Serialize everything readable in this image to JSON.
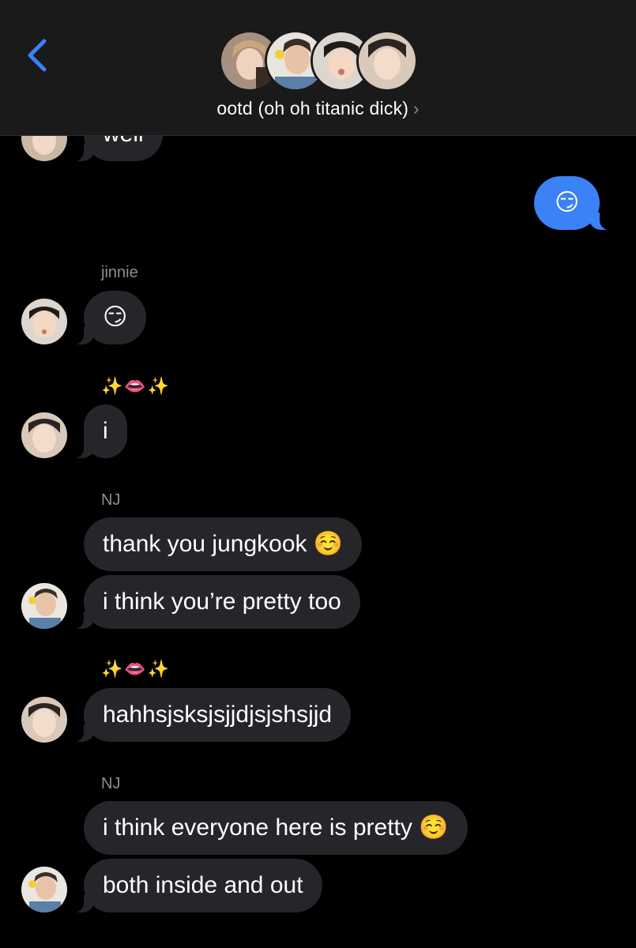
{
  "header": {
    "group_name": "ootd (oh oh titanic dick)",
    "chevron": "›",
    "back_icon": "chevron-left-icon",
    "accent_color": "#3b82f7"
  },
  "messages": {
    "cut_off_text": "well",
    "sent_emoji": "😏",
    "jinnie_name": "jinnie",
    "jinnie_msg": "😏",
    "jk_name_1": "✨👄✨",
    "jk_msg_1": "i",
    "nj_name_1": "NJ",
    "nj_msg_1": "thank you jungkook ☺️",
    "nj_msg_2": "i think you’re pretty too",
    "jk_name_2": "✨👄✨",
    "jk_msg_2": "hahhsjsksjsjjdjsjshsjjd",
    "nj_name_2": "NJ",
    "nj_msg_3": "i think everyone here is pretty ☺️",
    "nj_msg_4": "both inside and out"
  },
  "colors": {
    "received_bubble": "#26262a",
    "sent_bubble": "#3b82f7",
    "background": "#000000",
    "header_bg": "#1a1a1a"
  }
}
